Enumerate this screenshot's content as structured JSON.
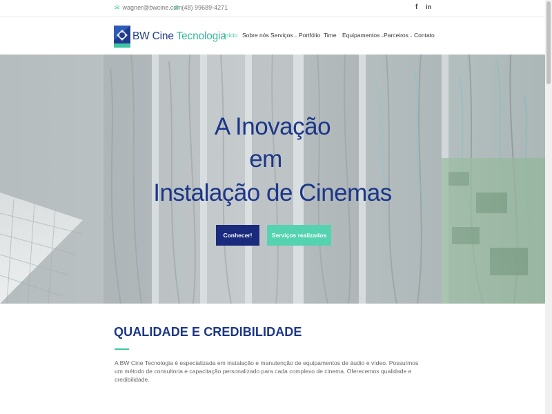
{
  "topbar": {
    "email": "wagner@bwcine.com",
    "email_icon": "envelope-icon",
    "phone": "(48) 99689-4271",
    "phone_icon": "phone-icon",
    "social": {
      "facebook": "f",
      "linkedin": "in"
    }
  },
  "logo": {
    "bw": "BW Cine",
    "tec": " Tecnologia"
  },
  "nav": {
    "items": [
      {
        "label": "Início",
        "active": true
      },
      {
        "label": "Sobre nós"
      },
      {
        "label": "Serviços",
        "dropdown": true
      },
      {
        "label": "Portfólio"
      },
      {
        "label": "Time"
      },
      {
        "label": "Equipamentos",
        "dropdown": true
      },
      {
        "label": "Parceiros",
        "dropdown": true
      },
      {
        "label": "Contato"
      }
    ]
  },
  "hero": {
    "line1": "A Inovação",
    "line2": "em",
    "line3": "Instalação de Cinemas",
    "primary_button": "Conhecer!",
    "secondary_button": "Serviços realizados"
  },
  "section": {
    "title": "QUALIDADE E CREDIBILIDADE",
    "text": "A BW Cine Tecnologia é especializada em instalação e manutenção de equipamentos de áudio e vídeo. Possuímos um método de consultoria e capacitação personalizado para cada complexo de cinema. Oferecemos qualidade e credibilidade."
  },
  "colors": {
    "brand_blue": "#1c3688",
    "accent_green": "#3cc6a1",
    "button_dark": "#1a2a7c",
    "button_green": "#55d3b0"
  }
}
